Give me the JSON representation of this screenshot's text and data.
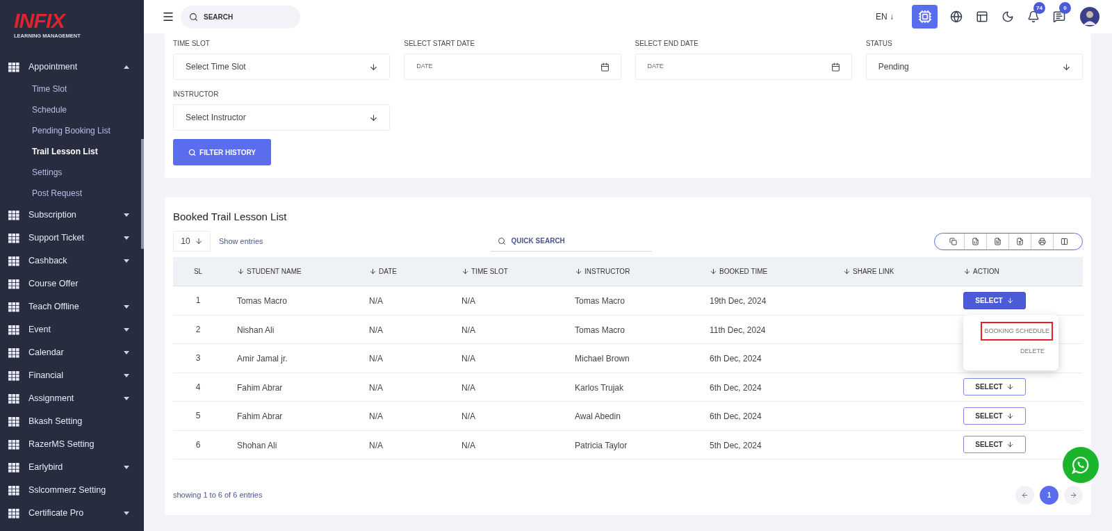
{
  "logo": {
    "brand": "INFIX",
    "tagline": "LEARNING MANAGEMENT"
  },
  "sidebar": {
    "items": [
      {
        "label": "Appointment",
        "expandable": true,
        "expanded": true,
        "children": [
          {
            "label": "Time Slot",
            "selected": false
          },
          {
            "label": "Schedule",
            "selected": false
          },
          {
            "label": "Pending Booking List",
            "selected": false
          },
          {
            "label": "Trail Lesson List",
            "selected": true
          },
          {
            "label": "Settings",
            "selected": false
          },
          {
            "label": "Post Request",
            "selected": false
          }
        ]
      },
      {
        "label": "Subscription",
        "expandable": true,
        "expanded": false
      },
      {
        "label": "Support Ticket",
        "expandable": true,
        "expanded": false
      },
      {
        "label": "Cashback",
        "expandable": true,
        "expanded": false
      },
      {
        "label": "Course Offer",
        "expandable": false
      },
      {
        "label": "Teach Offline",
        "expandable": true,
        "expanded": false
      },
      {
        "label": "Event",
        "expandable": true,
        "expanded": false
      },
      {
        "label": "Calendar",
        "expandable": true,
        "expanded": false
      },
      {
        "label": "Financial",
        "expandable": true,
        "expanded": false
      },
      {
        "label": "Assignment",
        "expandable": true,
        "expanded": false
      },
      {
        "label": "Bkash Setting",
        "expandable": false
      },
      {
        "label": "RazerMS Setting",
        "expandable": false
      },
      {
        "label": "Earlybird",
        "expandable": true,
        "expanded": false
      },
      {
        "label": "Sslcommerz Setting",
        "expandable": false
      },
      {
        "label": "Certificate Pro",
        "expandable": true,
        "expanded": false
      }
    ]
  },
  "topbar": {
    "search_placeholder": "SEARCH",
    "language": "EN ↓",
    "notifications": "74",
    "messages": "0"
  },
  "filters": {
    "fields": [
      {
        "label": "TIME SLOT",
        "kind": "select",
        "value": "Select Time Slot",
        "placeholder": false
      },
      {
        "label": "SELECT START DATE",
        "kind": "date",
        "value": "DATE",
        "placeholder": true
      },
      {
        "label": "SELECT END DATE",
        "kind": "date",
        "value": "DATE",
        "placeholder": true
      },
      {
        "label": "STATUS",
        "kind": "select",
        "value": "Pending",
        "placeholder": false
      },
      {
        "label": "INSTRUCTOR",
        "kind": "select",
        "value": "Select Instructor",
        "placeholder": false
      }
    ],
    "button": "FILTER HISTORY"
  },
  "table_card": {
    "title": "Booked Trail Lesson List",
    "page_size": "10",
    "page_size_label": "Show entries",
    "search_placeholder": "QUICK SEARCH",
    "columns": [
      {
        "label": "SL",
        "sortable": false
      },
      {
        "label": "STUDENT NAME",
        "sortable": true
      },
      {
        "label": "DATE",
        "sortable": true
      },
      {
        "label": "TIME SLOT",
        "sortable": true
      },
      {
        "label": "INSTRUCTOR",
        "sortable": true
      },
      {
        "label": "BOOKED TIME",
        "sortable": true
      },
      {
        "label": "SHARE LINK",
        "sortable": true
      },
      {
        "label": "ACTION",
        "sortable": true
      }
    ],
    "rows": [
      {
        "cells": [
          "1",
          "Tomas Macro",
          "N/A",
          "N/A",
          "Tomas Macro",
          "19th Dec, 2024",
          ""
        ],
        "action": "SELECT",
        "action_open": true
      },
      {
        "cells": [
          "2",
          "Nishan Ali",
          "N/A",
          "N/A",
          "Tomas Macro",
          "11th Dec, 2024",
          ""
        ]
      },
      {
        "cells": [
          "3",
          "Amir Jamal jr.",
          "N/A",
          "N/A",
          "Michael Brown",
          "6th Dec, 2024",
          ""
        ]
      },
      {
        "cells": [
          "4",
          "Fahim Abrar",
          "N/A",
          "N/A",
          "Karlos Trujak",
          "6th Dec, 2024",
          ""
        ],
        "action": "SELECT",
        "action_open": false
      },
      {
        "cells": [
          "5",
          "Fahim Abrar",
          "N/A",
          "N/A",
          "Awal Abedin",
          "6th Dec, 2024",
          ""
        ],
        "action": "SELECT",
        "action_open": false
      },
      {
        "cells": [
          "6",
          "Shohan Ali",
          "N/A",
          "N/A",
          "Patricia Taylor",
          "5th Dec, 2024",
          ""
        ],
        "action": "SELECT",
        "action_open": false
      }
    ],
    "action_menu": [
      {
        "label": "BOOKING SCHEDULE",
        "highlighted": true
      },
      {
        "label": "DELETE",
        "highlighted": false
      }
    ],
    "footer": "showing 1 to 6 of 6 entries",
    "pages": [
      {
        "label": "1",
        "selected": true
      }
    ]
  }
}
